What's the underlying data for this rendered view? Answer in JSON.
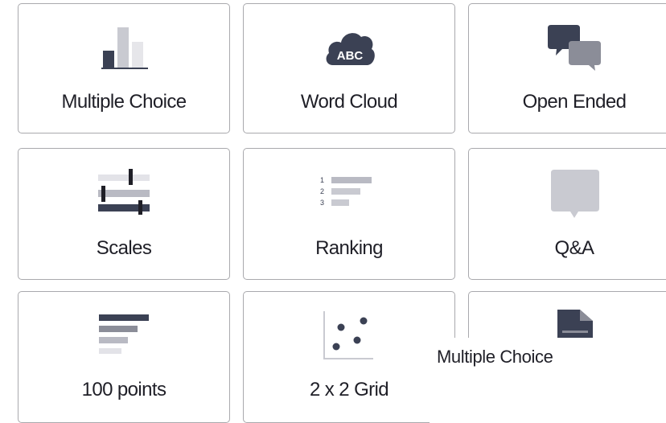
{
  "cards": [
    {
      "label": "Multiple Choice",
      "icon": "bar-chart-icon"
    },
    {
      "label": "Word Cloud",
      "icon": "word-cloud-icon"
    },
    {
      "label": "Open Ended",
      "icon": "chat-bubbles-icon"
    },
    {
      "label": "Scales",
      "icon": "sliders-icon"
    },
    {
      "label": "Ranking",
      "icon": "ranking-list-icon"
    },
    {
      "label": "Q&A",
      "icon": "speech-bubble-icon"
    },
    {
      "label": "100 points",
      "icon": "horizontal-bars-icon"
    },
    {
      "label": "2 x 2 Grid",
      "icon": "scatter-grid-icon"
    },
    {
      "label": "",
      "icon": "document-icon"
    }
  ],
  "word_cloud_icon_text": "ABC",
  "ranking_numbers": [
    "1",
    "2",
    "3"
  ],
  "tooltip": {
    "text": "Multiple Choice"
  },
  "colors": {
    "dark": "#3b4154",
    "mid": "#8b8d98",
    "light": "#c9cad1",
    "border": "#a9a9ad"
  }
}
